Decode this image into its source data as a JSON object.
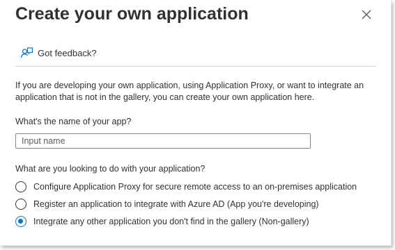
{
  "header": {
    "title": "Create your own application"
  },
  "feedback": {
    "label": "Got feedback?"
  },
  "description": "If you are developing your own application, using Application Proxy, or want to integrate an application that is not in the gallery, you can create your own application here.",
  "name_field": {
    "label": "What's the name of your app?",
    "placeholder": "Input name",
    "value": ""
  },
  "purpose": {
    "question": "What are you looking to do with your application?",
    "options": [
      {
        "label": "Configure Application Proxy for secure remote access to an on-premises application",
        "selected": false
      },
      {
        "label": "Register an application to integrate with Azure AD (App you're developing)",
        "selected": false
      },
      {
        "label": "Integrate any other application you don't find in the gallery (Non-gallery)",
        "selected": true
      }
    ]
  },
  "colors": {
    "accent": "#0078d4",
    "text": "#323130",
    "border": "#8a8886"
  },
  "icons": {
    "close": "close-icon",
    "feedback": "feedback-icon",
    "radio_unselected": "radio-unchecked",
    "radio_selected": "radio-checked"
  }
}
